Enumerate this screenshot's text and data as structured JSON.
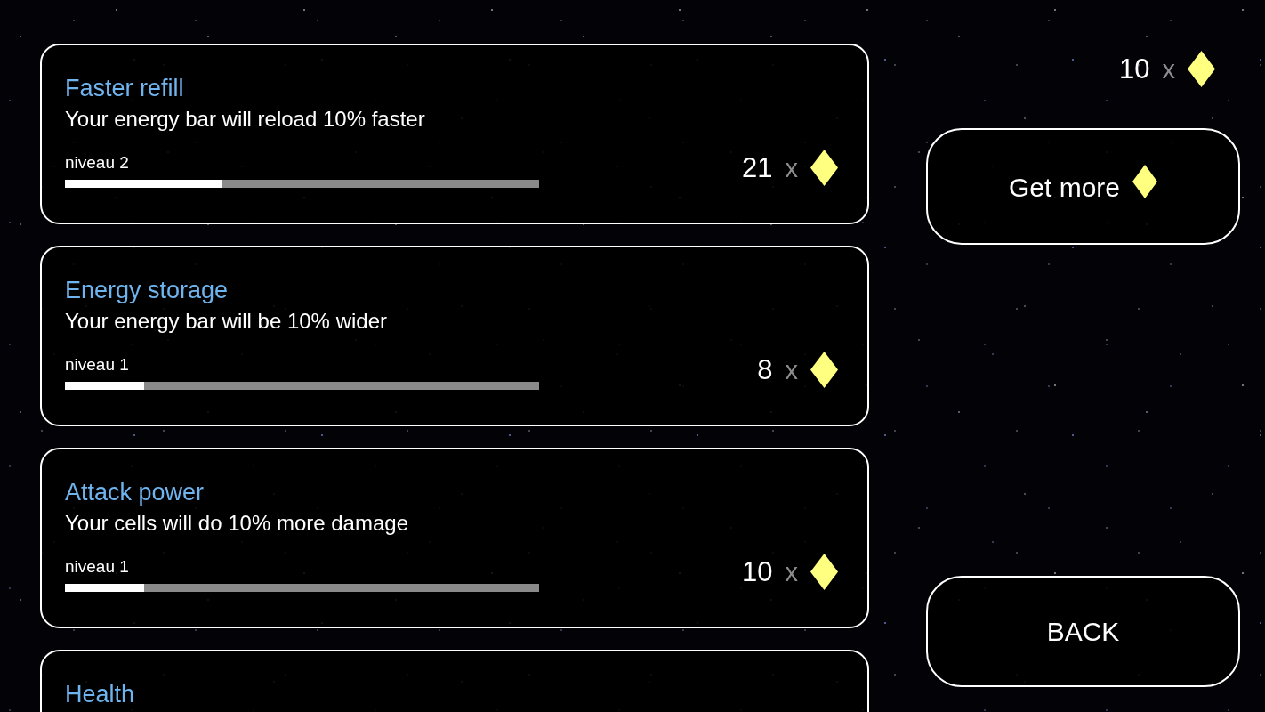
{
  "upgrades": [
    {
      "title": "Faster refill",
      "description": "Your energy bar will reload 10% faster",
      "level_label": "niveau 2",
      "level": 0.333,
      "price": "21",
      "times": "x"
    },
    {
      "title": "Energy storage",
      "description": "Your energy bar will be 10% wider",
      "level_label": "niveau 1",
      "level": 0.167,
      "price": "8",
      "times": "x"
    },
    {
      "title": "Attack power",
      "description": "Your cells will do 10% more damage",
      "level_label": "niveau 1",
      "level": 0.167,
      "price": "10",
      "times": "x"
    },
    {
      "title": "Health"
    }
  ],
  "wallet": {
    "amount": "10",
    "times": "x"
  },
  "get_more_button": {
    "label": "Get more"
  },
  "back_button": {
    "label": "BACK"
  }
}
